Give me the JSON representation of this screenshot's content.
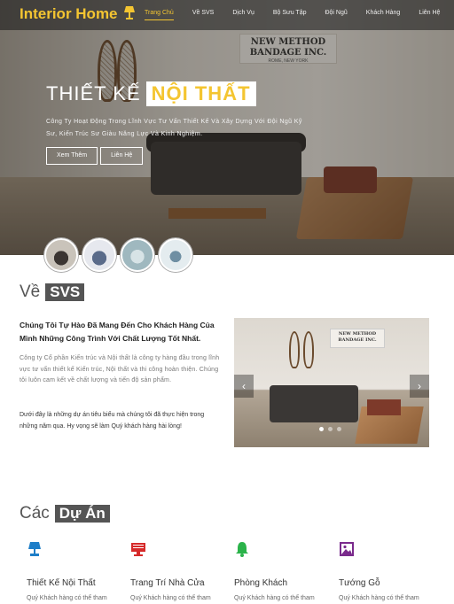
{
  "brand": {
    "name": "Interior Home",
    "accent": "#f4c531"
  },
  "nav": {
    "items": [
      {
        "label": "Trang Chủ",
        "active": true
      },
      {
        "label": "Về SVS"
      },
      {
        "label": "Dịch Vụ"
      },
      {
        "label": "Bộ Sưu Tập"
      },
      {
        "label": "Đội Ngũ"
      },
      {
        "label": "Khách Hàng"
      },
      {
        "label": "Liên Hệ"
      }
    ]
  },
  "hero": {
    "title_plain": "THIẾT KẾ",
    "title_highlight": "NỘI THẤT",
    "description": "Công Ty Hoạt Động Trong Lĩnh Vực Tư Vấn Thiết Kế Và Xây Dựng Với Đội Ngũ Kỹ Sư, Kiến Trúc Sư Giàu Năng Lực Và Kinh Nghiệm.",
    "btn_view": "Xem Thêm",
    "btn_contact": "Liên Hệ",
    "sign_line1": "NEW METHOD",
    "sign_line2": "BANDAGE INC.",
    "sign_line3": "ROME, NEW YORK"
  },
  "about": {
    "title_plain": "Về",
    "title_highlight": "SVS",
    "lead": "Chúng Tôi Tự Hào Đã Mang Đến Cho Khách Hàng Của Mình Những Công Trình Với Chất Lượng Tốt Nhất.",
    "p1": "Công ty Cổ phần Kiến trúc và Nội thất là công ty hàng đầu trong lĩnh vực tư vấn thiết kế Kiến trúc, Nội thất và thi công hoàn thiện. Chúng tôi luôn cam kết về chất lượng và tiến độ sản phẩm.",
    "p2": "Dưới đây là những dự án tiêu biểu mà chúng tôi đã thực hiện trong những năm qua. Hy vọng sẽ làm Quý khách hàng hài lòng!",
    "slider_prev": "‹",
    "slider_next": "›",
    "slider_sign1": "NEW METHOD",
    "slider_sign2": "BANDAGE INC."
  },
  "projects": {
    "title_plain": "Các",
    "title_highlight": "Dự Án",
    "cards": [
      {
        "title": "Thiết Kế Nội Thất",
        "desc": "Quý Khách hàng có thể tham",
        "icon": "lamp-icon"
      },
      {
        "title": "Trang Trí Nhà Cửa",
        "desc": "Quý Khách hàng có thể tham",
        "icon": "monitor-icon"
      },
      {
        "title": "Phòng Khách",
        "desc": "Quý Khách hàng có thể tham",
        "icon": "bell-icon"
      },
      {
        "title": "Tướng Gỗ",
        "desc": "Quý Khách hàng có thể tham",
        "icon": "image-icon"
      }
    ]
  }
}
